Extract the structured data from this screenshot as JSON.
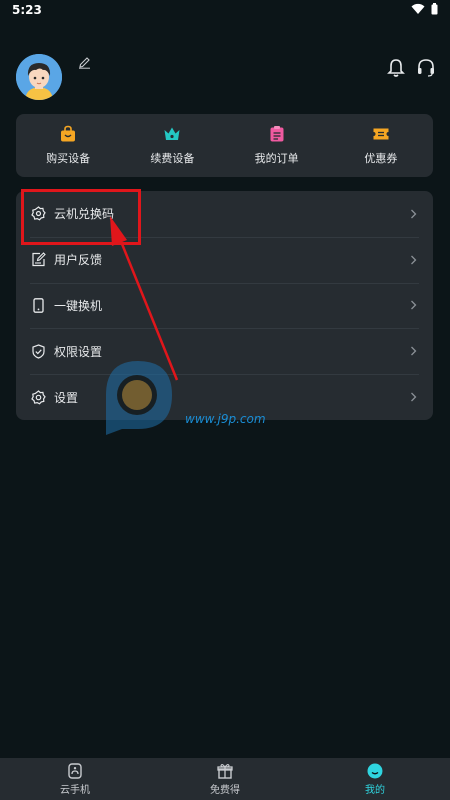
{
  "status_bar": {
    "time": "5:23",
    "icons": [
      "wifi-icon",
      "battery-icon"
    ]
  },
  "header": {
    "avatar": "avatar",
    "edit_icon": "edit-icon",
    "notification_icon": "bell-icon",
    "support_icon": "headset-icon"
  },
  "quick_actions": [
    {
      "label": "购买设备",
      "icon": "shopping-bag-icon",
      "color": "#f5a623"
    },
    {
      "label": "续费设备",
      "icon": "crown-icon",
      "color": "#24c8c4"
    },
    {
      "label": "我的订单",
      "icon": "order-list-icon",
      "color": "#ef5aa0"
    },
    {
      "label": "优惠券",
      "icon": "coupon-icon",
      "color": "#f5a623"
    }
  ],
  "menu": [
    {
      "label": "云机兑换码",
      "icon": "gear-badge-icon"
    },
    {
      "label": "用户反馈",
      "icon": "feedback-edit-icon"
    },
    {
      "label": "一键换机",
      "icon": "phone-icon"
    },
    {
      "label": "权限设置",
      "icon": "shield-check-icon"
    },
    {
      "label": "设置",
      "icon": "settings-gear-icon"
    }
  ],
  "watermark": {
    "text": "www.j9p.com"
  },
  "bottom_nav": [
    {
      "label": "云手机",
      "icon": "cloud-phone-icon",
      "active": false
    },
    {
      "label": "免费得",
      "icon": "gift-icon",
      "active": false
    },
    {
      "label": "我的",
      "icon": "profile-face-icon",
      "active": true
    }
  ],
  "colors": {
    "background": "#0c1518",
    "card": "#262c31",
    "accent": "#2fd5e0",
    "highlight": "#e0161b"
  }
}
